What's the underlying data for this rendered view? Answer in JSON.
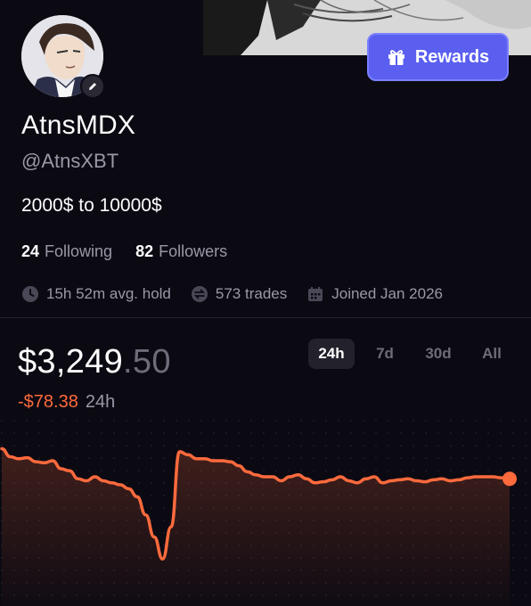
{
  "profile": {
    "name": "AtnsMDX",
    "handle": "@AtnsXBT",
    "bio": "2000$ to 10000$",
    "following_count": "24",
    "following_label": "Following",
    "followers_count": "82",
    "followers_label": "Followers"
  },
  "stats": {
    "avg_hold": "15h 52m avg. hold",
    "trades": "573 trades",
    "joined": "Joined Jan 2026"
  },
  "rewards": {
    "label": "Rewards"
  },
  "balance": {
    "dollars": "$3,249",
    "cents": ".50",
    "change": "-$78.38",
    "change_period": "24h"
  },
  "ranges": [
    {
      "label": "24h",
      "active": true
    },
    {
      "label": "7d",
      "active": false
    },
    {
      "label": "30d",
      "active": false
    },
    {
      "label": "All",
      "active": false
    }
  ],
  "colors": {
    "accent": "#5a5ff0",
    "negative": "#ff6a3d",
    "background": "#0b0a12",
    "muted": "#9a98a6"
  },
  "icons": {
    "rewards": "gift-icon",
    "avg_hold": "clock-icon",
    "trades": "swap-icon",
    "joined": "calendar-icon",
    "edit": "pencil-icon"
  },
  "chart_data": {
    "type": "area",
    "title": "",
    "xlabel": "",
    "ylabel": "",
    "ylim": [
      3180,
      3340
    ],
    "x": [
      0,
      1,
      2,
      3,
      4,
      5,
      6,
      7,
      8,
      9,
      10,
      11,
      12,
      13,
      14,
      15,
      16,
      17,
      18,
      19,
      20,
      21,
      22,
      23,
      24,
      25,
      26,
      27,
      28,
      29,
      30,
      31,
      32,
      33,
      34,
      35,
      36,
      37,
      38,
      39,
      40,
      41,
      42,
      43,
      44,
      45,
      46,
      47,
      48,
      49,
      50,
      51,
      52,
      53,
      54,
      55,
      56,
      57,
      58,
      59,
      60
    ],
    "values": [
      3328,
      3320,
      3318,
      3319,
      3315,
      3314,
      3316,
      3308,
      3306,
      3298,
      3296,
      3300,
      3296,
      3294,
      3292,
      3288,
      3280,
      3262,
      3240,
      3218,
      3250,
      3325,
      3322,
      3318,
      3318,
      3316,
      3316,
      3315,
      3311,
      3305,
      3302,
      3300,
      3300,
      3296,
      3300,
      3302,
      3298,
      3294,
      3295,
      3297,
      3300,
      3296,
      3294,
      3298,
      3300,
      3294,
      3296,
      3297,
      3298,
      3296,
      3295,
      3297,
      3298,
      3296,
      3297,
      3299,
      3300,
      3300,
      3300,
      3299,
      3298
    ],
    "grid": false,
    "legend": "none"
  }
}
